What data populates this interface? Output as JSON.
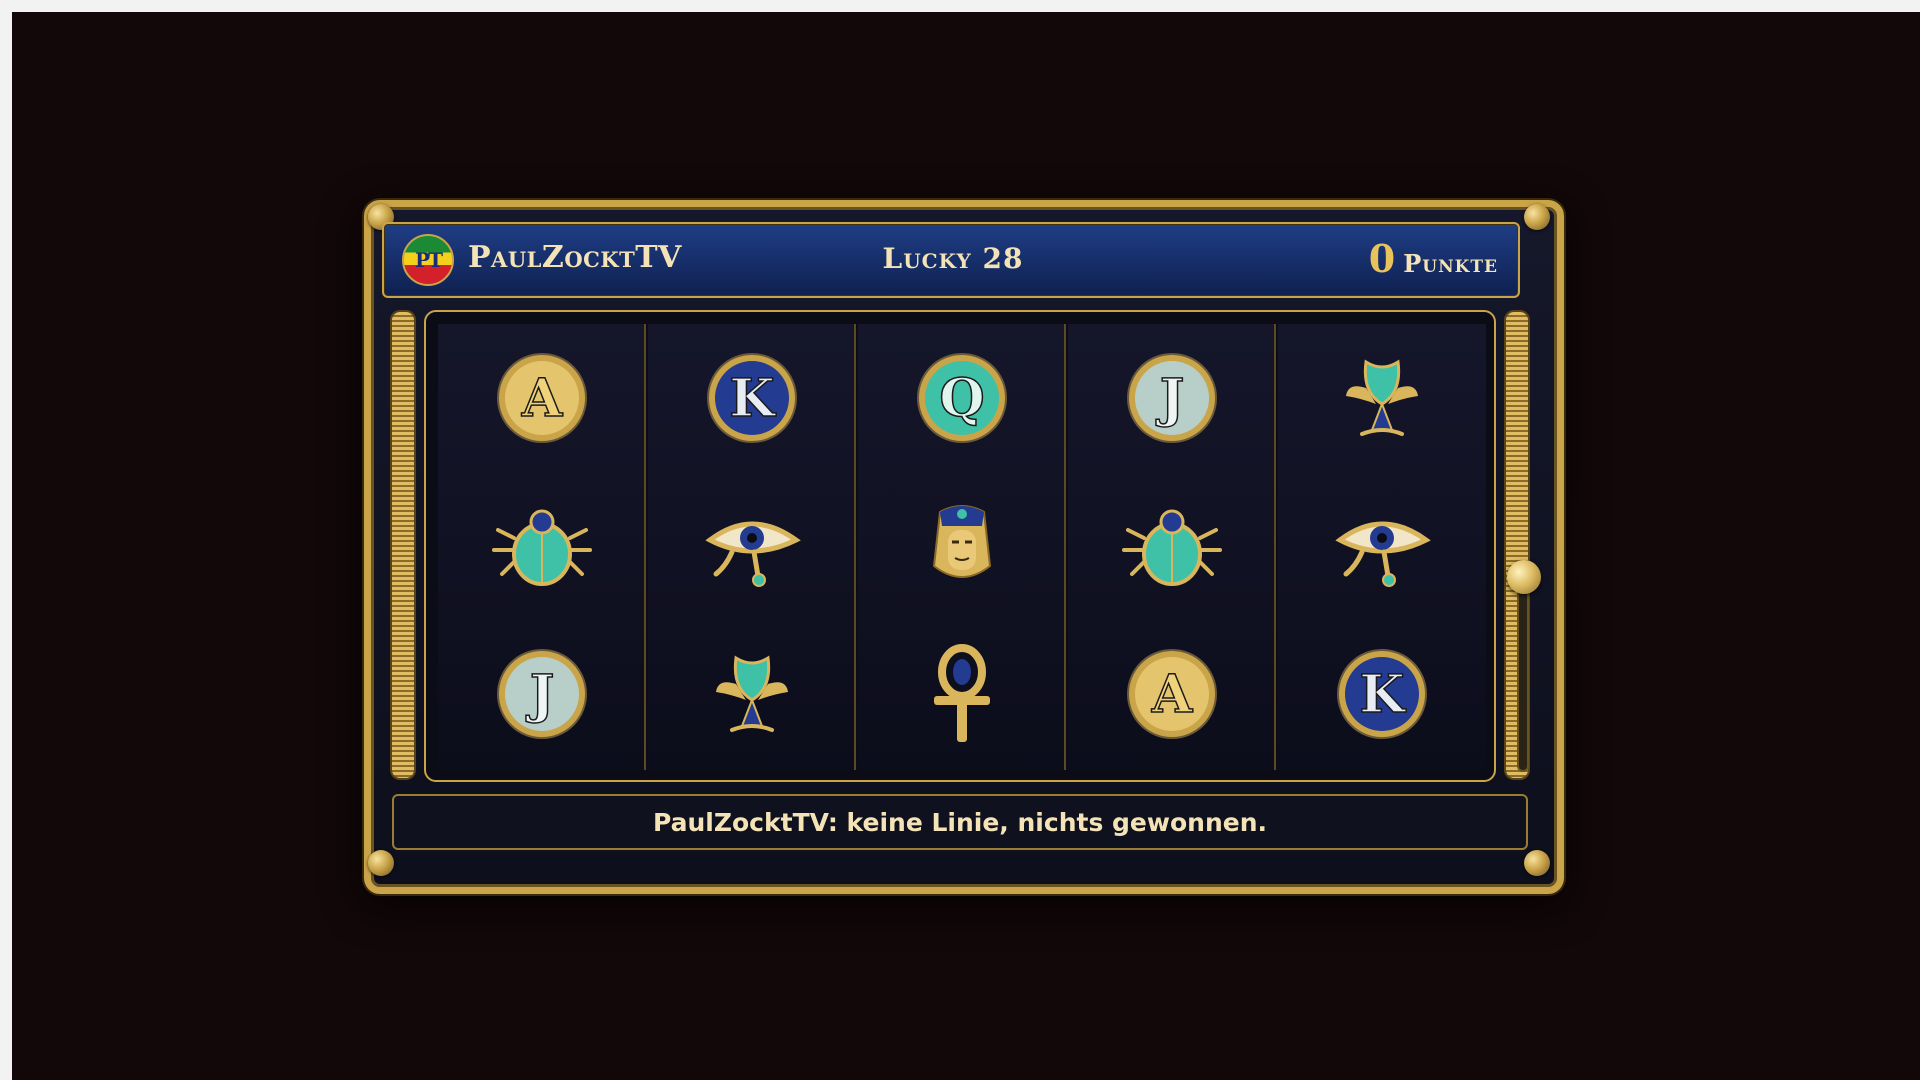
{
  "header": {
    "brand": "PaulZocktTV",
    "logo_text": "PT",
    "title": "Lucky 28",
    "score_value": "0",
    "score_label": "Punkte"
  },
  "reels": [
    [
      "A",
      "scarab",
      "J"
    ],
    [
      "K",
      "eye",
      "lotus"
    ],
    [
      "Q",
      "pharaoh",
      "ankh"
    ],
    [
      "J",
      "scarab",
      "A"
    ],
    [
      "lotus",
      "eye",
      "K"
    ]
  ],
  "symbol_icons": {
    "A": "letter-a-coin-icon",
    "K": "letter-k-coin-icon",
    "Q": "letter-q-coin-icon",
    "J": "letter-j-coin-icon",
    "scarab": "scarab-icon",
    "eye": "eye-of-horus-icon",
    "pharaoh": "pharaoh-mask-icon",
    "ankh": "ankh-icon",
    "lotus": "lotus-icon"
  },
  "message": "PaulZocktTV: keine Linie, nichts gewonnen.",
  "colors": {
    "background": "#120709",
    "gold": "#c9a449",
    "header_blue": "#1f3e86",
    "text_cream": "#f4e3b6",
    "turquoise": "#3ec1a6",
    "lapis": "#233b91"
  }
}
